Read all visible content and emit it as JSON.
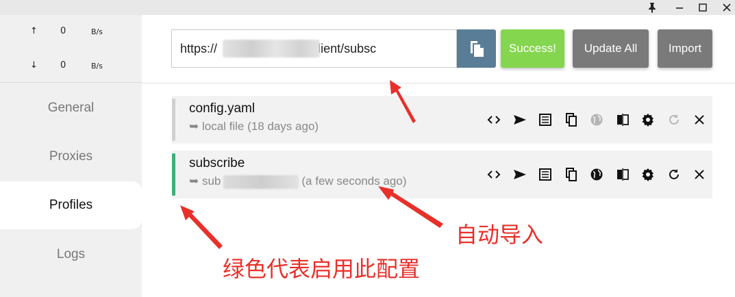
{
  "window": {
    "pin_icon": "pin-icon",
    "minimize_icon": "minimize-icon",
    "maximize_icon": "maximize-icon",
    "close_icon": "close-icon"
  },
  "traffic": {
    "upload": {
      "arrow": "↑",
      "value": "0",
      "unit": "B/s"
    },
    "download": {
      "arrow": "↓",
      "value": "0",
      "unit": "B/s"
    }
  },
  "sidebar": {
    "items": [
      {
        "label": "General",
        "active": false
      },
      {
        "label": "Proxies",
        "active": false
      },
      {
        "label": "Profiles",
        "active": true
      },
      {
        "label": "Logs",
        "active": false
      }
    ]
  },
  "toolbar": {
    "url_value": "https://                /api/v1/client/subsc",
    "copy_icon": "paste-icon",
    "success_label": "Success!",
    "update_all_label": "Update All",
    "import_label": "Import"
  },
  "profiles": [
    {
      "name": "config.yaml",
      "subtitle": "➥ local file (18 days ago)",
      "active": false,
      "indicator_color": "#d0d0d0"
    },
    {
      "name": "subscribe",
      "subtitle_prefix": "➥ sub",
      "subtitle_suffix": "(a few seconds ago)",
      "active": true,
      "indicator_color": "#3cb07a"
    }
  ],
  "profile_actions": [
    "code-icon",
    "send-icon",
    "list-icon",
    "copy-icon",
    "globe-icon",
    "compare-icon",
    "gear-icon",
    "refresh-icon",
    "close-icon"
  ],
  "annotations": {
    "auto_import": "自动导入",
    "green_active": "绿色代表启用此配置",
    "color": "#e8302a"
  },
  "colors": {
    "accent_blue": "#5a7d97",
    "success_green": "#85d64f",
    "gray_button": "#7a7a7a",
    "active_indicator": "#3cb07a"
  }
}
